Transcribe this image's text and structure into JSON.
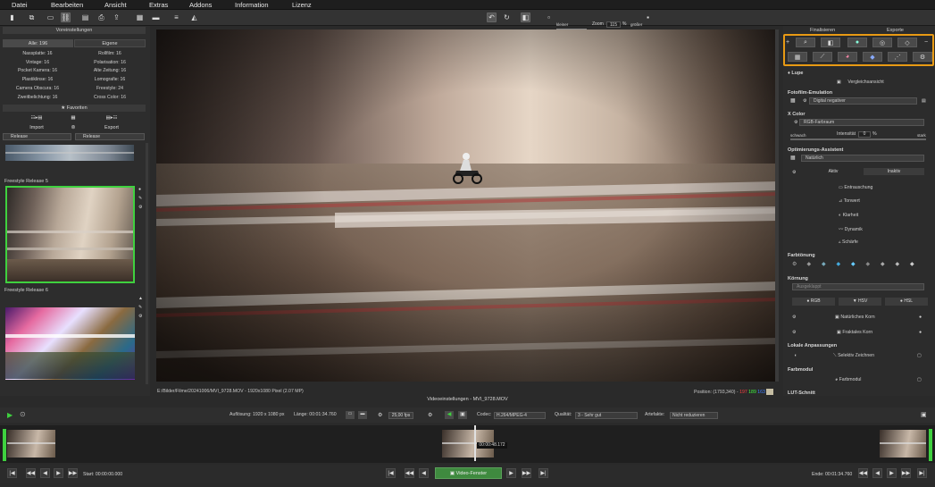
{
  "menu": [
    "Datei",
    "Bearbeiten",
    "Ansicht",
    "Extras",
    "Addons",
    "Information",
    "Lizenz"
  ],
  "toolbar": {
    "kleiner": "kleiner",
    "zoom_label": "Zoom",
    "zoom_value": "115",
    "zoom_unit": "%",
    "groesser": "größer"
  },
  "left": {
    "title": "Voreinstellungen",
    "tabs": [
      "Alle: 196",
      "Eigene"
    ],
    "presets": [
      [
        "Nassplatte: 16",
        "Rollfilm: 16"
      ],
      [
        "Vintage: 16",
        "Polarisation: 16"
      ],
      [
        "Pocket Kamera: 16",
        "Alte Zeitung: 16"
      ],
      [
        "Plastiklinse: 16",
        "Lomografie: 16"
      ],
      [
        "Camera Obscura: 16",
        "Freestyle: 24"
      ],
      [
        "Zweitbelichtung: 16",
        "Cross Color: 16"
      ]
    ],
    "favorites": "★ Favoriten",
    "import": "Import",
    "export": "Export",
    "filter1": "Release",
    "filter2": "Release",
    "thumb5": "Freestyle Release 5",
    "thumb6": "Freestyle Release 6"
  },
  "viewer": {
    "path": "E:/Bilder/Filme/20241006/MVI_9728.MOV - 1920x1080 Pixel (2.07 MP)",
    "position": "Position: (1793,340) -",
    "r": "197",
    "g": "189",
    "b": "163"
  },
  "right": {
    "tabs": [
      "Finalisieren",
      "Exporte"
    ],
    "lupe": "Lupe",
    "vergleich": "Vergleichsansicht",
    "fotofilm_title": "Fotofilm-Emulation",
    "fotofilm_value": "Digital negativer",
    "xcolor_title": "X Color",
    "xcolor_value": "RGB-Farbraum",
    "schwach": "schwach",
    "intensitaet": "Intensität",
    "intens_val": "0",
    "intens_unit": "%",
    "stark": "stark",
    "opt_title": "Optimierungs-Assistent",
    "opt_value": "Natürlich",
    "aktiv": "Aktiv",
    "inaktiv": "Inaktiv",
    "opt_items": [
      "Entrauschung",
      "Tonwert",
      "Klarheit",
      "Dynamik",
      "Schärfe"
    ],
    "farbtonung": "Farbtönung",
    "koernung": "Körnung",
    "koernung_value": "Ausgeklappt",
    "rgb": "RGB",
    "hsv": "HSV",
    "hsl": "HSL",
    "korn1": "Natürliches Korn",
    "korn2": "Fraktales Korn",
    "lokale": "Lokale Anpassungen",
    "selektiv": "Selektiv Zeichnen",
    "farbmodul_title": "Farbmodul",
    "farbmodul": "Farbmodul",
    "lut": "LUT-Schnitt"
  },
  "bottom": {
    "title": "Videoeinstellungen - MVI_9728.MOV",
    "aufloesung": "Auflösung: 1920 x 1080 px",
    "laenge": "Länge: 00:01:34.760",
    "fps": "25,00 fps",
    "codec_label": "Codec:",
    "codec": "H.264/MPEG-4",
    "qualitaet_label": "Qualität:",
    "qualitaet": "3 - Sehr gut",
    "artefakte_label": "Artefakte:",
    "artefakte": "Nicht reduzieren",
    "marker_time": "00:00:48.172",
    "start": "Start: 00:00:00.000",
    "ende": "Ende: 00:01:34.760",
    "video_button": "Video-Fenster"
  },
  "colors": {
    "accent_orange": "#e89a14",
    "green_select": "#3fd13f",
    "r": "#ff4040",
    "g": "#40ff40",
    "b": "#4080ff"
  }
}
